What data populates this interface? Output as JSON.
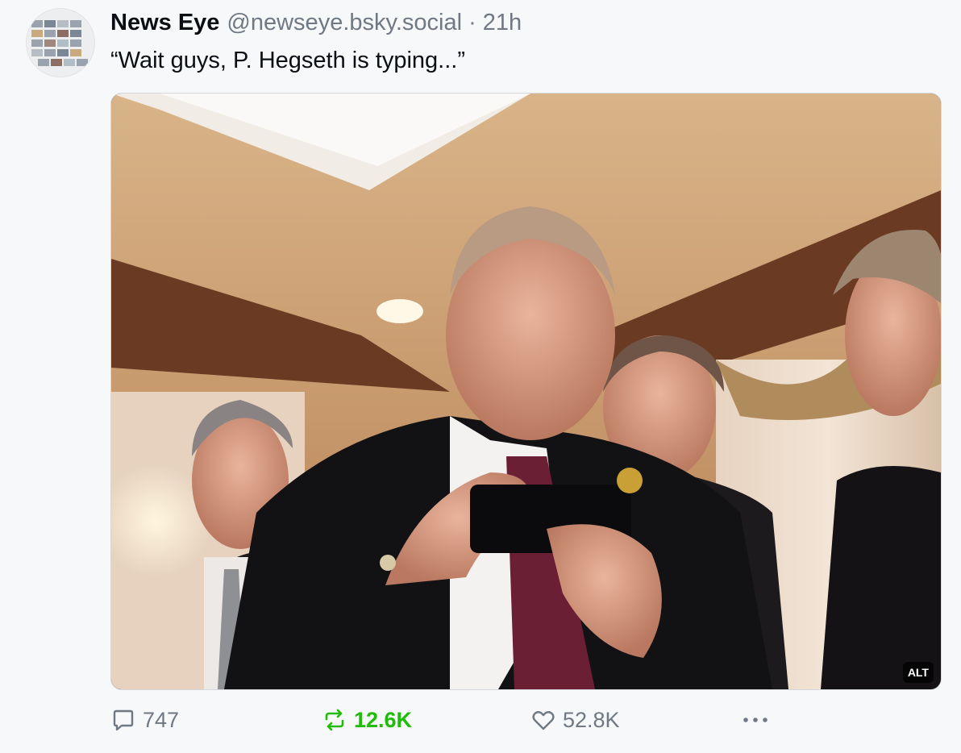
{
  "post": {
    "author_name": "News Eye",
    "author_handle": "@newseye.bsky.social",
    "separator": "·",
    "time": "21h",
    "text": "“Wait guys, P. Hegseth is typing...”",
    "image_alt_badge": "ALT"
  },
  "actions": {
    "reply_count": "747",
    "repost_count": "12.6K",
    "like_count": "52.8K"
  },
  "icons": {
    "reply": "reply-icon",
    "repost": "repost-icon",
    "like": "heart-icon",
    "more": "more-icon"
  },
  "colors": {
    "repost_active": "#20bc07",
    "muted": "#6f7883",
    "text": "#0b0f14",
    "background": "#f7f8f9"
  }
}
